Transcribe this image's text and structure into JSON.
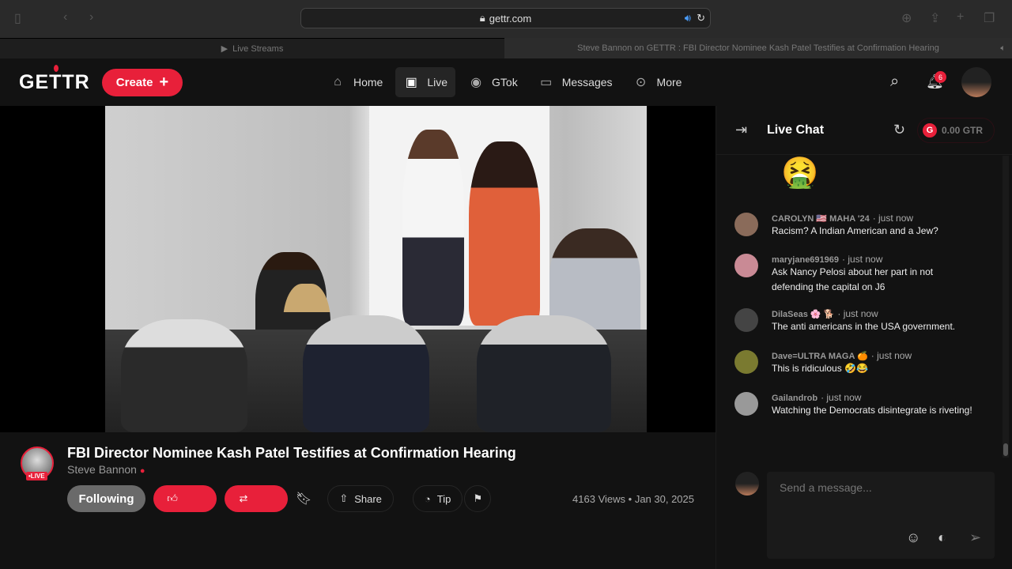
{
  "browser": {
    "url": "gettr.com",
    "tabs": [
      {
        "label": "Live Streams"
      },
      {
        "label": "Steve Bannon on GETTR : FBI Director Nominee Kash Patel Testifies at Confirmation Hearing"
      }
    ]
  },
  "nav": {
    "logo": "GETTR",
    "create": "Create",
    "items": [
      {
        "label": "Home",
        "icon": "home-icon"
      },
      {
        "label": "Live",
        "icon": "live-icon"
      },
      {
        "label": "GTok",
        "icon": "gtok-icon"
      },
      {
        "label": "Messages",
        "icon": "messages-icon"
      },
      {
        "label": "More",
        "icon": "more-icon"
      }
    ],
    "notifications": "6"
  },
  "video": {
    "title": "FBI Director Nominee Kash Patel Testifies at Confirmation Hearing",
    "author": "Steve Bannon",
    "live_badge": "•LIVE",
    "following": "Following",
    "share": "Share",
    "tip": "Tip",
    "views": "4163 Views",
    "date": "Jan 30, 2025"
  },
  "chat": {
    "title": "Live Chat",
    "balance": "0.00 GTR",
    "placeholder": "Send a message...",
    "messages": [
      {
        "name": "CAROLYN 🇺🇸 MAHA '24",
        "time": "· just now",
        "text": "Racism? A Indian American and a Jew?",
        "avatar": "#8a6b5a"
      },
      {
        "name": "maryjane691969",
        "time": "· just now",
        "text": "Ask Nancy Pelosi about her part in not defending the capital on J6",
        "avatar": "#c98a95"
      },
      {
        "name": "DilaSeas 🌸 🐕",
        "time": "· just now",
        "text": "The anti americans in the USA government.",
        "avatar": "#444"
      },
      {
        "name": "Dave=ULTRA MAGA 🍊",
        "time": "· just now",
        "text": "This is ridiculous 🤣😂",
        "avatar": "#7a7a30"
      },
      {
        "name": "Gailandrob",
        "time": "· just now",
        "text": "Watching the Democrats disintegrate is riveting!",
        "avatar": "#999"
      }
    ]
  },
  "colors": {
    "accent": "#e8203a",
    "bg": "#121212"
  }
}
